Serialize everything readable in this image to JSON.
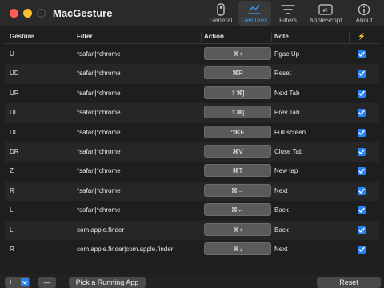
{
  "app_title": "MacGesture",
  "tabs": [
    {
      "label": "General",
      "icon": "general-icon",
      "active": false
    },
    {
      "label": "Gestures",
      "icon": "gestures-icon",
      "active": true
    },
    {
      "label": "Filters",
      "icon": "filters-icon",
      "active": false
    },
    {
      "label": "AppleScript",
      "icon": "applescript-icon",
      "active": false
    },
    {
      "label": "About",
      "icon": "about-icon",
      "active": false
    }
  ],
  "table": {
    "headers": {
      "gesture": "Gesture",
      "filter": "Filter",
      "action": "Action",
      "note": "Note",
      "enabled": "⚡"
    },
    "rows": [
      {
        "gesture": "U",
        "filter": "*safari|*chrome",
        "action": "⌘↑",
        "note": "Pgae Up",
        "enabled": true
      },
      {
        "gesture": "UD",
        "filter": "*safari|*chrome",
        "action": "⌘R",
        "note": "Reset",
        "enabled": true
      },
      {
        "gesture": "UR",
        "filter": "*safari|*chrome",
        "action": "⇧⌘]",
        "note": "Next Tab",
        "enabled": true
      },
      {
        "gesture": "UL",
        "filter": "*safari|*chrome",
        "action": "⇧⌘[",
        "note": "Prev Tab",
        "enabled": true
      },
      {
        "gesture": "DL",
        "filter": "*safari|*chrome",
        "action": "^⌘F",
        "note": "Full screen",
        "enabled": true
      },
      {
        "gesture": "DR",
        "filter": "*safari|*chrome",
        "action": "⌘V",
        "note": "Close Tab",
        "enabled": true
      },
      {
        "gesture": "Z",
        "filter": "*safari|*chrome",
        "action": "⌘T",
        "note": "New tap",
        "enabled": true
      },
      {
        "gesture": "R",
        "filter": "*safari|*chrome",
        "action": "⌘→",
        "note": "Next",
        "enabled": true
      },
      {
        "gesture": "L",
        "filter": "*safari|*chrome",
        "action": "⌘←",
        "note": "Back",
        "enabled": true
      },
      {
        "gesture": "L",
        "filter": "com.apple.finder",
        "action": "⌘↑",
        "note": "Back",
        "enabled": true
      },
      {
        "gesture": "R",
        "filter": "com.apple.finder|com.apple.finder",
        "action": "⌘↓",
        "note": "Next",
        "enabled": true
      }
    ]
  },
  "bottom": {
    "add_label": "+",
    "remove_label": "—",
    "pick_label": "Pick a Running App",
    "reset_label": "Reset"
  },
  "colors": {
    "accent": "#2a82f7",
    "accent_text": "#3b9cff",
    "background": "#1e1e1e"
  }
}
